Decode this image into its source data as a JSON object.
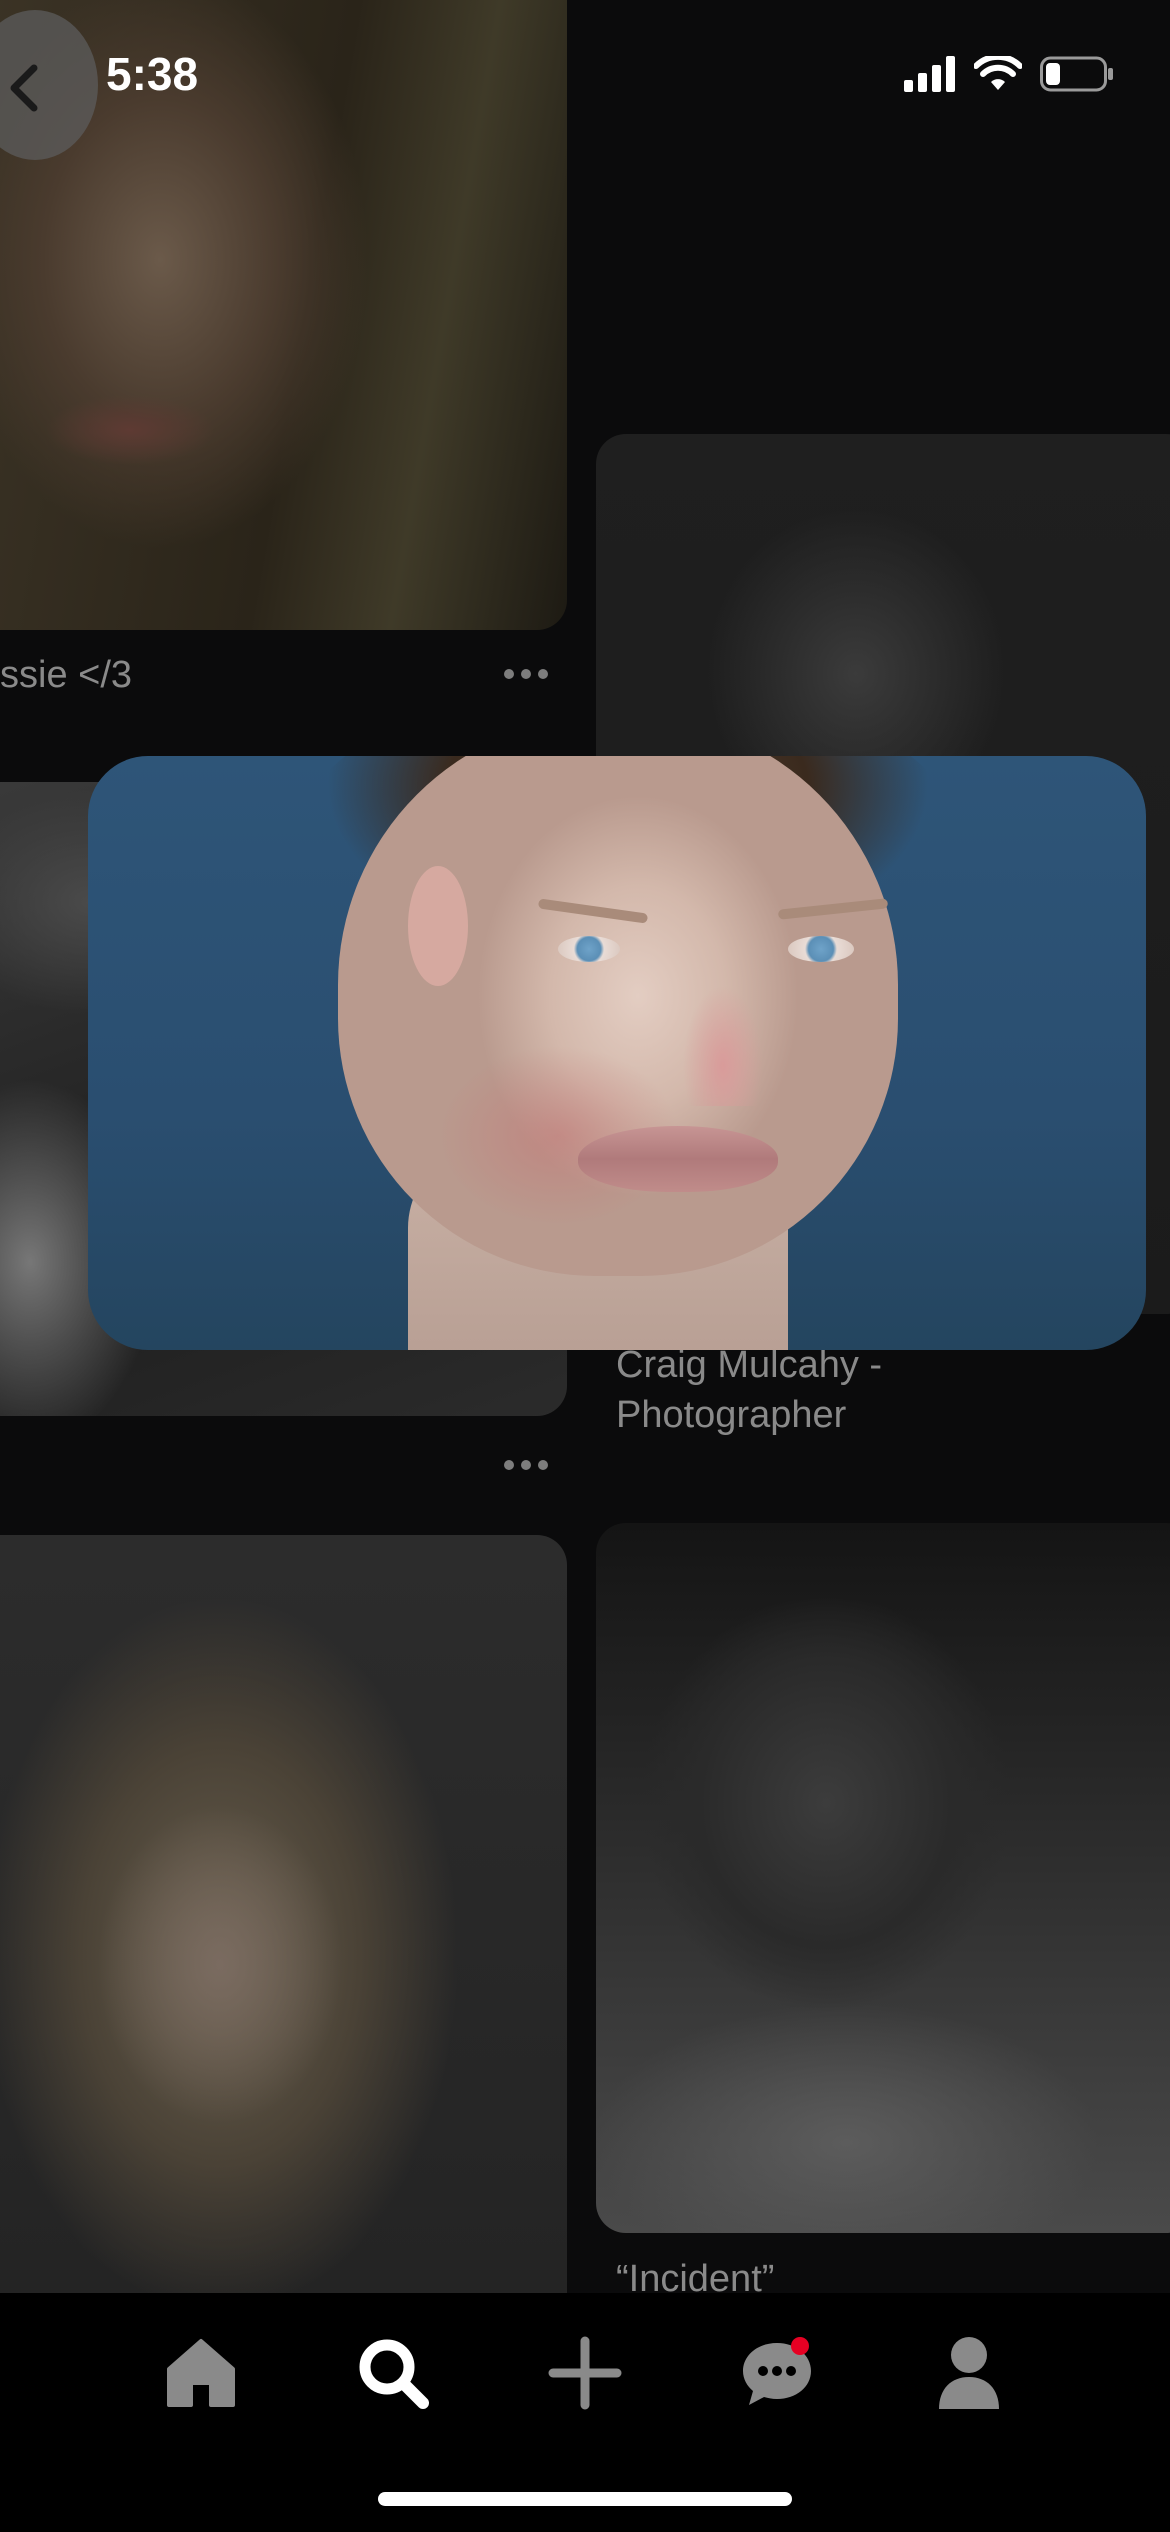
{
  "status_bar": {
    "time": "5:38",
    "icons": [
      "cellular-signal-icon",
      "wifi-icon",
      "battery-icon"
    ]
  },
  "navigation": {
    "back_icon": "chevron-left-icon"
  },
  "pins": [
    {
      "title": "ssie </3"
    },
    {
      "title": "Craig Mulcahy - Photographer"
    },
    {
      "title": "“Incident”"
    }
  ],
  "tab_bar": {
    "tabs": [
      {
        "icon": "home-icon",
        "active": false
      },
      {
        "icon": "search-icon",
        "active": true
      },
      {
        "icon": "plus-icon",
        "active": false
      },
      {
        "icon": "messages-icon",
        "active": false,
        "badge": true
      },
      {
        "icon": "profile-icon",
        "active": false
      }
    ]
  },
  "colors": {
    "background": "#0b0b0c",
    "caption_gray": "#8a8a8a",
    "tab_inactive": "#8a8a8a",
    "tab_active": "#ffffff",
    "badge_red": "#e60023"
  }
}
